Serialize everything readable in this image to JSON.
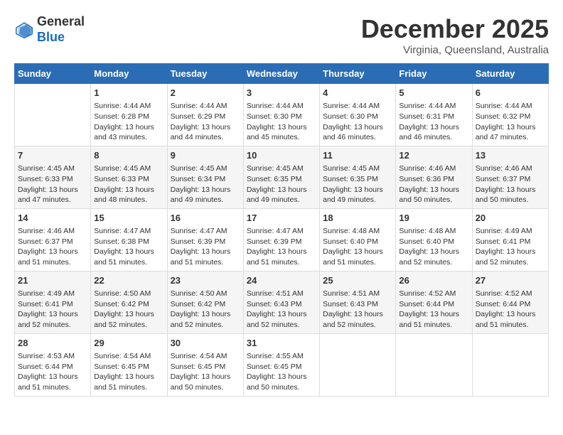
{
  "header": {
    "logo_line1": "General",
    "logo_line2": "Blue",
    "month_title": "December 2025",
    "subtitle": "Virginia, Queensland, Australia"
  },
  "calendar": {
    "days_of_week": [
      "Sunday",
      "Monday",
      "Tuesday",
      "Wednesday",
      "Thursday",
      "Friday",
      "Saturday"
    ],
    "weeks": [
      [
        {
          "day": "",
          "detail": ""
        },
        {
          "day": "1",
          "detail": "Sunrise: 4:44 AM\nSunset: 6:28 PM\nDaylight: 13 hours\nand 43 minutes."
        },
        {
          "day": "2",
          "detail": "Sunrise: 4:44 AM\nSunset: 6:29 PM\nDaylight: 13 hours\nand 44 minutes."
        },
        {
          "day": "3",
          "detail": "Sunrise: 4:44 AM\nSunset: 6:30 PM\nDaylight: 13 hours\nand 45 minutes."
        },
        {
          "day": "4",
          "detail": "Sunrise: 4:44 AM\nSunset: 6:30 PM\nDaylight: 13 hours\nand 46 minutes."
        },
        {
          "day": "5",
          "detail": "Sunrise: 4:44 AM\nSunset: 6:31 PM\nDaylight: 13 hours\nand 46 minutes."
        },
        {
          "day": "6",
          "detail": "Sunrise: 4:44 AM\nSunset: 6:32 PM\nDaylight: 13 hours\nand 47 minutes."
        }
      ],
      [
        {
          "day": "7",
          "detail": "Sunrise: 4:45 AM\nSunset: 6:33 PM\nDaylight: 13 hours\nand 47 minutes."
        },
        {
          "day": "8",
          "detail": "Sunrise: 4:45 AM\nSunset: 6:33 PM\nDaylight: 13 hours\nand 48 minutes."
        },
        {
          "day": "9",
          "detail": "Sunrise: 4:45 AM\nSunset: 6:34 PM\nDaylight: 13 hours\nand 49 minutes."
        },
        {
          "day": "10",
          "detail": "Sunrise: 4:45 AM\nSunset: 6:35 PM\nDaylight: 13 hours\nand 49 minutes."
        },
        {
          "day": "11",
          "detail": "Sunrise: 4:45 AM\nSunset: 6:35 PM\nDaylight: 13 hours\nand 49 minutes."
        },
        {
          "day": "12",
          "detail": "Sunrise: 4:46 AM\nSunset: 6:36 PM\nDaylight: 13 hours\nand 50 minutes."
        },
        {
          "day": "13",
          "detail": "Sunrise: 4:46 AM\nSunset: 6:37 PM\nDaylight: 13 hours\nand 50 minutes."
        }
      ],
      [
        {
          "day": "14",
          "detail": "Sunrise: 4:46 AM\nSunset: 6:37 PM\nDaylight: 13 hours\nand 51 minutes."
        },
        {
          "day": "15",
          "detail": "Sunrise: 4:47 AM\nSunset: 6:38 PM\nDaylight: 13 hours\nand 51 minutes."
        },
        {
          "day": "16",
          "detail": "Sunrise: 4:47 AM\nSunset: 6:39 PM\nDaylight: 13 hours\nand 51 minutes."
        },
        {
          "day": "17",
          "detail": "Sunrise: 4:47 AM\nSunset: 6:39 PM\nDaylight: 13 hours\nand 51 minutes."
        },
        {
          "day": "18",
          "detail": "Sunrise: 4:48 AM\nSunset: 6:40 PM\nDaylight: 13 hours\nand 51 minutes."
        },
        {
          "day": "19",
          "detail": "Sunrise: 4:48 AM\nSunset: 6:40 PM\nDaylight: 13 hours\nand 52 minutes."
        },
        {
          "day": "20",
          "detail": "Sunrise: 4:49 AM\nSunset: 6:41 PM\nDaylight: 13 hours\nand 52 minutes."
        }
      ],
      [
        {
          "day": "21",
          "detail": "Sunrise: 4:49 AM\nSunset: 6:41 PM\nDaylight: 13 hours\nand 52 minutes."
        },
        {
          "day": "22",
          "detail": "Sunrise: 4:50 AM\nSunset: 6:42 PM\nDaylight: 13 hours\nand 52 minutes."
        },
        {
          "day": "23",
          "detail": "Sunrise: 4:50 AM\nSunset: 6:42 PM\nDaylight: 13 hours\nand 52 minutes."
        },
        {
          "day": "24",
          "detail": "Sunrise: 4:51 AM\nSunset: 6:43 PM\nDaylight: 13 hours\nand 52 minutes."
        },
        {
          "day": "25",
          "detail": "Sunrise: 4:51 AM\nSunset: 6:43 PM\nDaylight: 13 hours\nand 52 minutes."
        },
        {
          "day": "26",
          "detail": "Sunrise: 4:52 AM\nSunset: 6:44 PM\nDaylight: 13 hours\nand 51 minutes."
        },
        {
          "day": "27",
          "detail": "Sunrise: 4:52 AM\nSunset: 6:44 PM\nDaylight: 13 hours\nand 51 minutes."
        }
      ],
      [
        {
          "day": "28",
          "detail": "Sunrise: 4:53 AM\nSunset: 6:44 PM\nDaylight: 13 hours\nand 51 minutes."
        },
        {
          "day": "29",
          "detail": "Sunrise: 4:54 AM\nSunset: 6:45 PM\nDaylight: 13 hours\nand 51 minutes."
        },
        {
          "day": "30",
          "detail": "Sunrise: 4:54 AM\nSunset: 6:45 PM\nDaylight: 13 hours\nand 50 minutes."
        },
        {
          "day": "31",
          "detail": "Sunrise: 4:55 AM\nSunset: 6:45 PM\nDaylight: 13 hours\nand 50 minutes."
        },
        {
          "day": "",
          "detail": ""
        },
        {
          "day": "",
          "detail": ""
        },
        {
          "day": "",
          "detail": ""
        }
      ]
    ]
  }
}
